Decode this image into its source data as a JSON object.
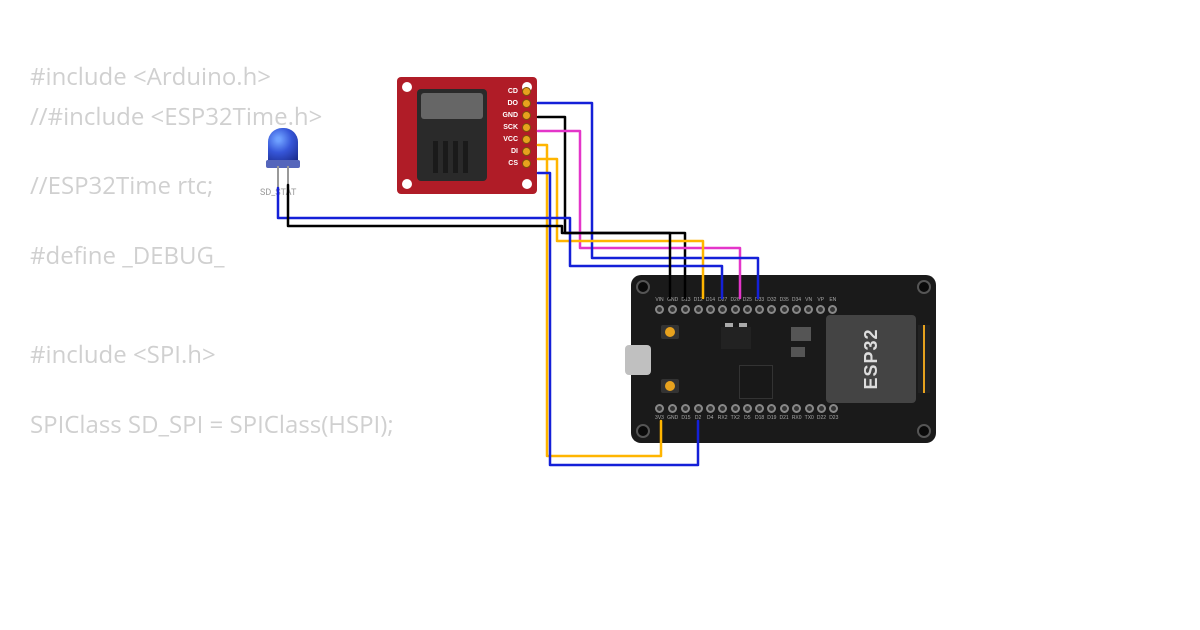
{
  "code_lines": [
    "#include <Arduino.h>",
    "//#include <ESP32Time.h>",
    "",
    "//ESP32Time rtc;",
    "",
    "#define _DEBUG_",
    "",
    "",
    "#include <SPI.h>",
    "",
    "SPIClass SD_SPI = SPIClass(HSPI);"
  ],
  "led": {
    "label": "SD_STAT",
    "color": "#3656d8"
  },
  "sd_module": {
    "pins": [
      "CD",
      "DO",
      "GND",
      "SCK",
      "VCC",
      "DI",
      "CS"
    ]
  },
  "esp32": {
    "shield_label": "ESP32",
    "top_pins": [
      "VIN",
      "GND",
      "D13",
      "D12",
      "D14",
      "D27",
      "D26",
      "D25",
      "D33",
      "D32",
      "D35",
      "D34",
      "VN",
      "VP",
      "EN"
    ],
    "bottom_pins": [
      "3V3",
      "GND",
      "D15",
      "D2",
      "D4",
      "RX2",
      "TX2",
      "D5",
      "D18",
      "D19",
      "D21",
      "RX0",
      "TX0",
      "D22",
      "D23"
    ]
  },
  "wires": {
    "colors": {
      "gnd": "#000000",
      "sck": "#e435c9",
      "vcc": "#ffb500",
      "di": "#ffb500",
      "cs": "#1420d8",
      "do": "#1420d8",
      "led": "#1420d8",
      "led_gnd": "#000000"
    },
    "connections": [
      {
        "from": "SD.GND",
        "to": "ESP32.GND_top"
      },
      {
        "from": "SD.SCK",
        "to": "ESP32.D14"
      },
      {
        "from": "SD.VCC",
        "to": "ESP32.3V3"
      },
      {
        "from": "SD.DI",
        "to": "ESP32.D13"
      },
      {
        "from": "SD.CS",
        "to": "ESP32.D15"
      },
      {
        "from": "SD.DO",
        "to": "ESP32.D12"
      },
      {
        "from": "LED.anode",
        "to": "ESP32.D27"
      },
      {
        "from": "LED.cathode",
        "to": "ESP32.GND"
      }
    ]
  }
}
